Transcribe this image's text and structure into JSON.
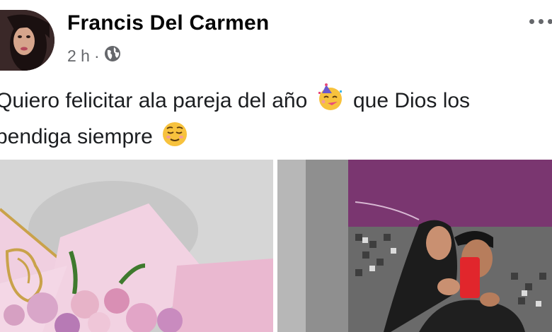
{
  "post": {
    "author": "Francis Del Carmen",
    "time": "2 h",
    "separator": "·",
    "privacy_icon": "globe-icon",
    "more_icon": "more-options-icon",
    "text_line1": "Quiero felicitar ala pareja del año",
    "text_line1b": "que Dios los",
    "text_line2": "bendiga siempre",
    "emoji1": "partying-face-emoji",
    "emoji2": "relieved-face-emoji"
  },
  "photos": [
    {
      "description_icon": "flower-bouquet-photo"
    },
    {
      "description_icon": "couple-selfie-photo"
    }
  ],
  "colors": {
    "name": "#050505",
    "meta": "#65676b",
    "wall_purple": "#7a3670"
  }
}
